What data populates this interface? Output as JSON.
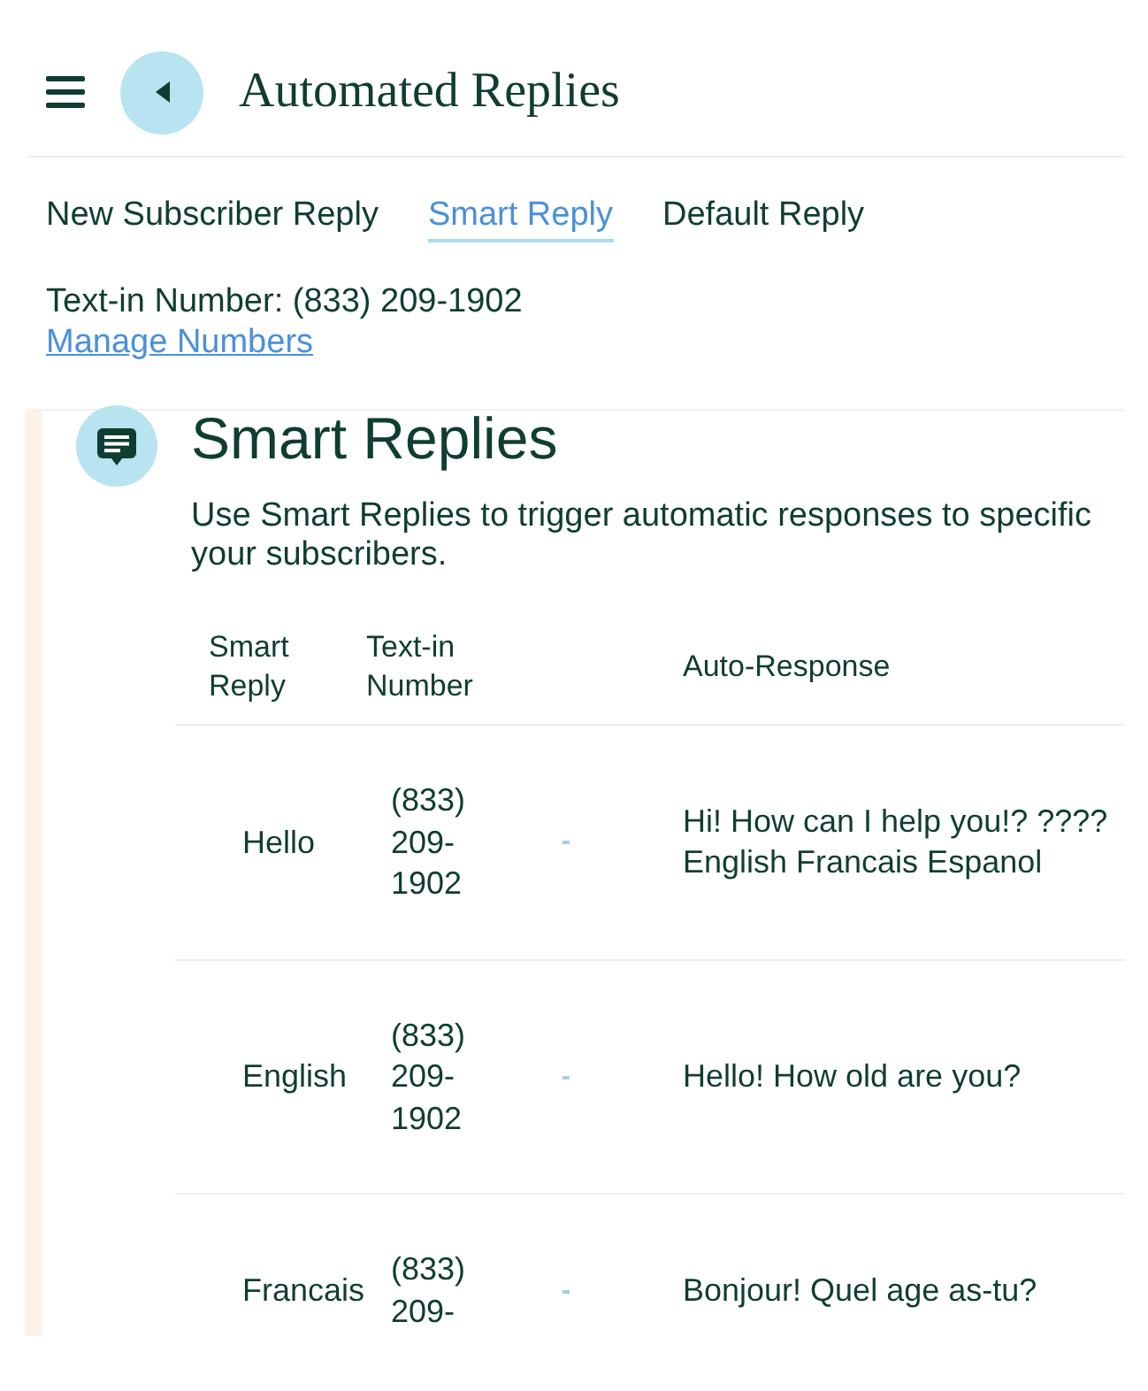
{
  "header": {
    "title": "Automated Replies"
  },
  "tabs": [
    {
      "label": "New Subscriber Reply",
      "selected": false
    },
    {
      "label": "Smart Reply",
      "selected": true
    },
    {
      "label": "Default Reply",
      "selected": false
    }
  ],
  "number_info": {
    "text": "Text-in Number: (833) 209-1902",
    "link": "Manage Numbers"
  },
  "section": {
    "title": "Smart Replies",
    "description": "Use Smart Replies to trigger automatic responses to specific your subscribers.",
    "table": {
      "columns": [
        "Smart Reply",
        "Text-in Number",
        "Auto-Response"
      ],
      "rows": [
        {
          "smart_reply": "Hello",
          "number": "(833) 209-1902",
          "response": "Hi! How can I help you!? ???? English Francais Espanol"
        },
        {
          "smart_reply": "English",
          "number": "(833) 209-1902",
          "response": "Hello! How old are you?"
        },
        {
          "smart_reply": "Francais",
          "number": "(833) 209-",
          "response": "Bonjour! Quel age as-tu?"
        }
      ]
    }
  }
}
